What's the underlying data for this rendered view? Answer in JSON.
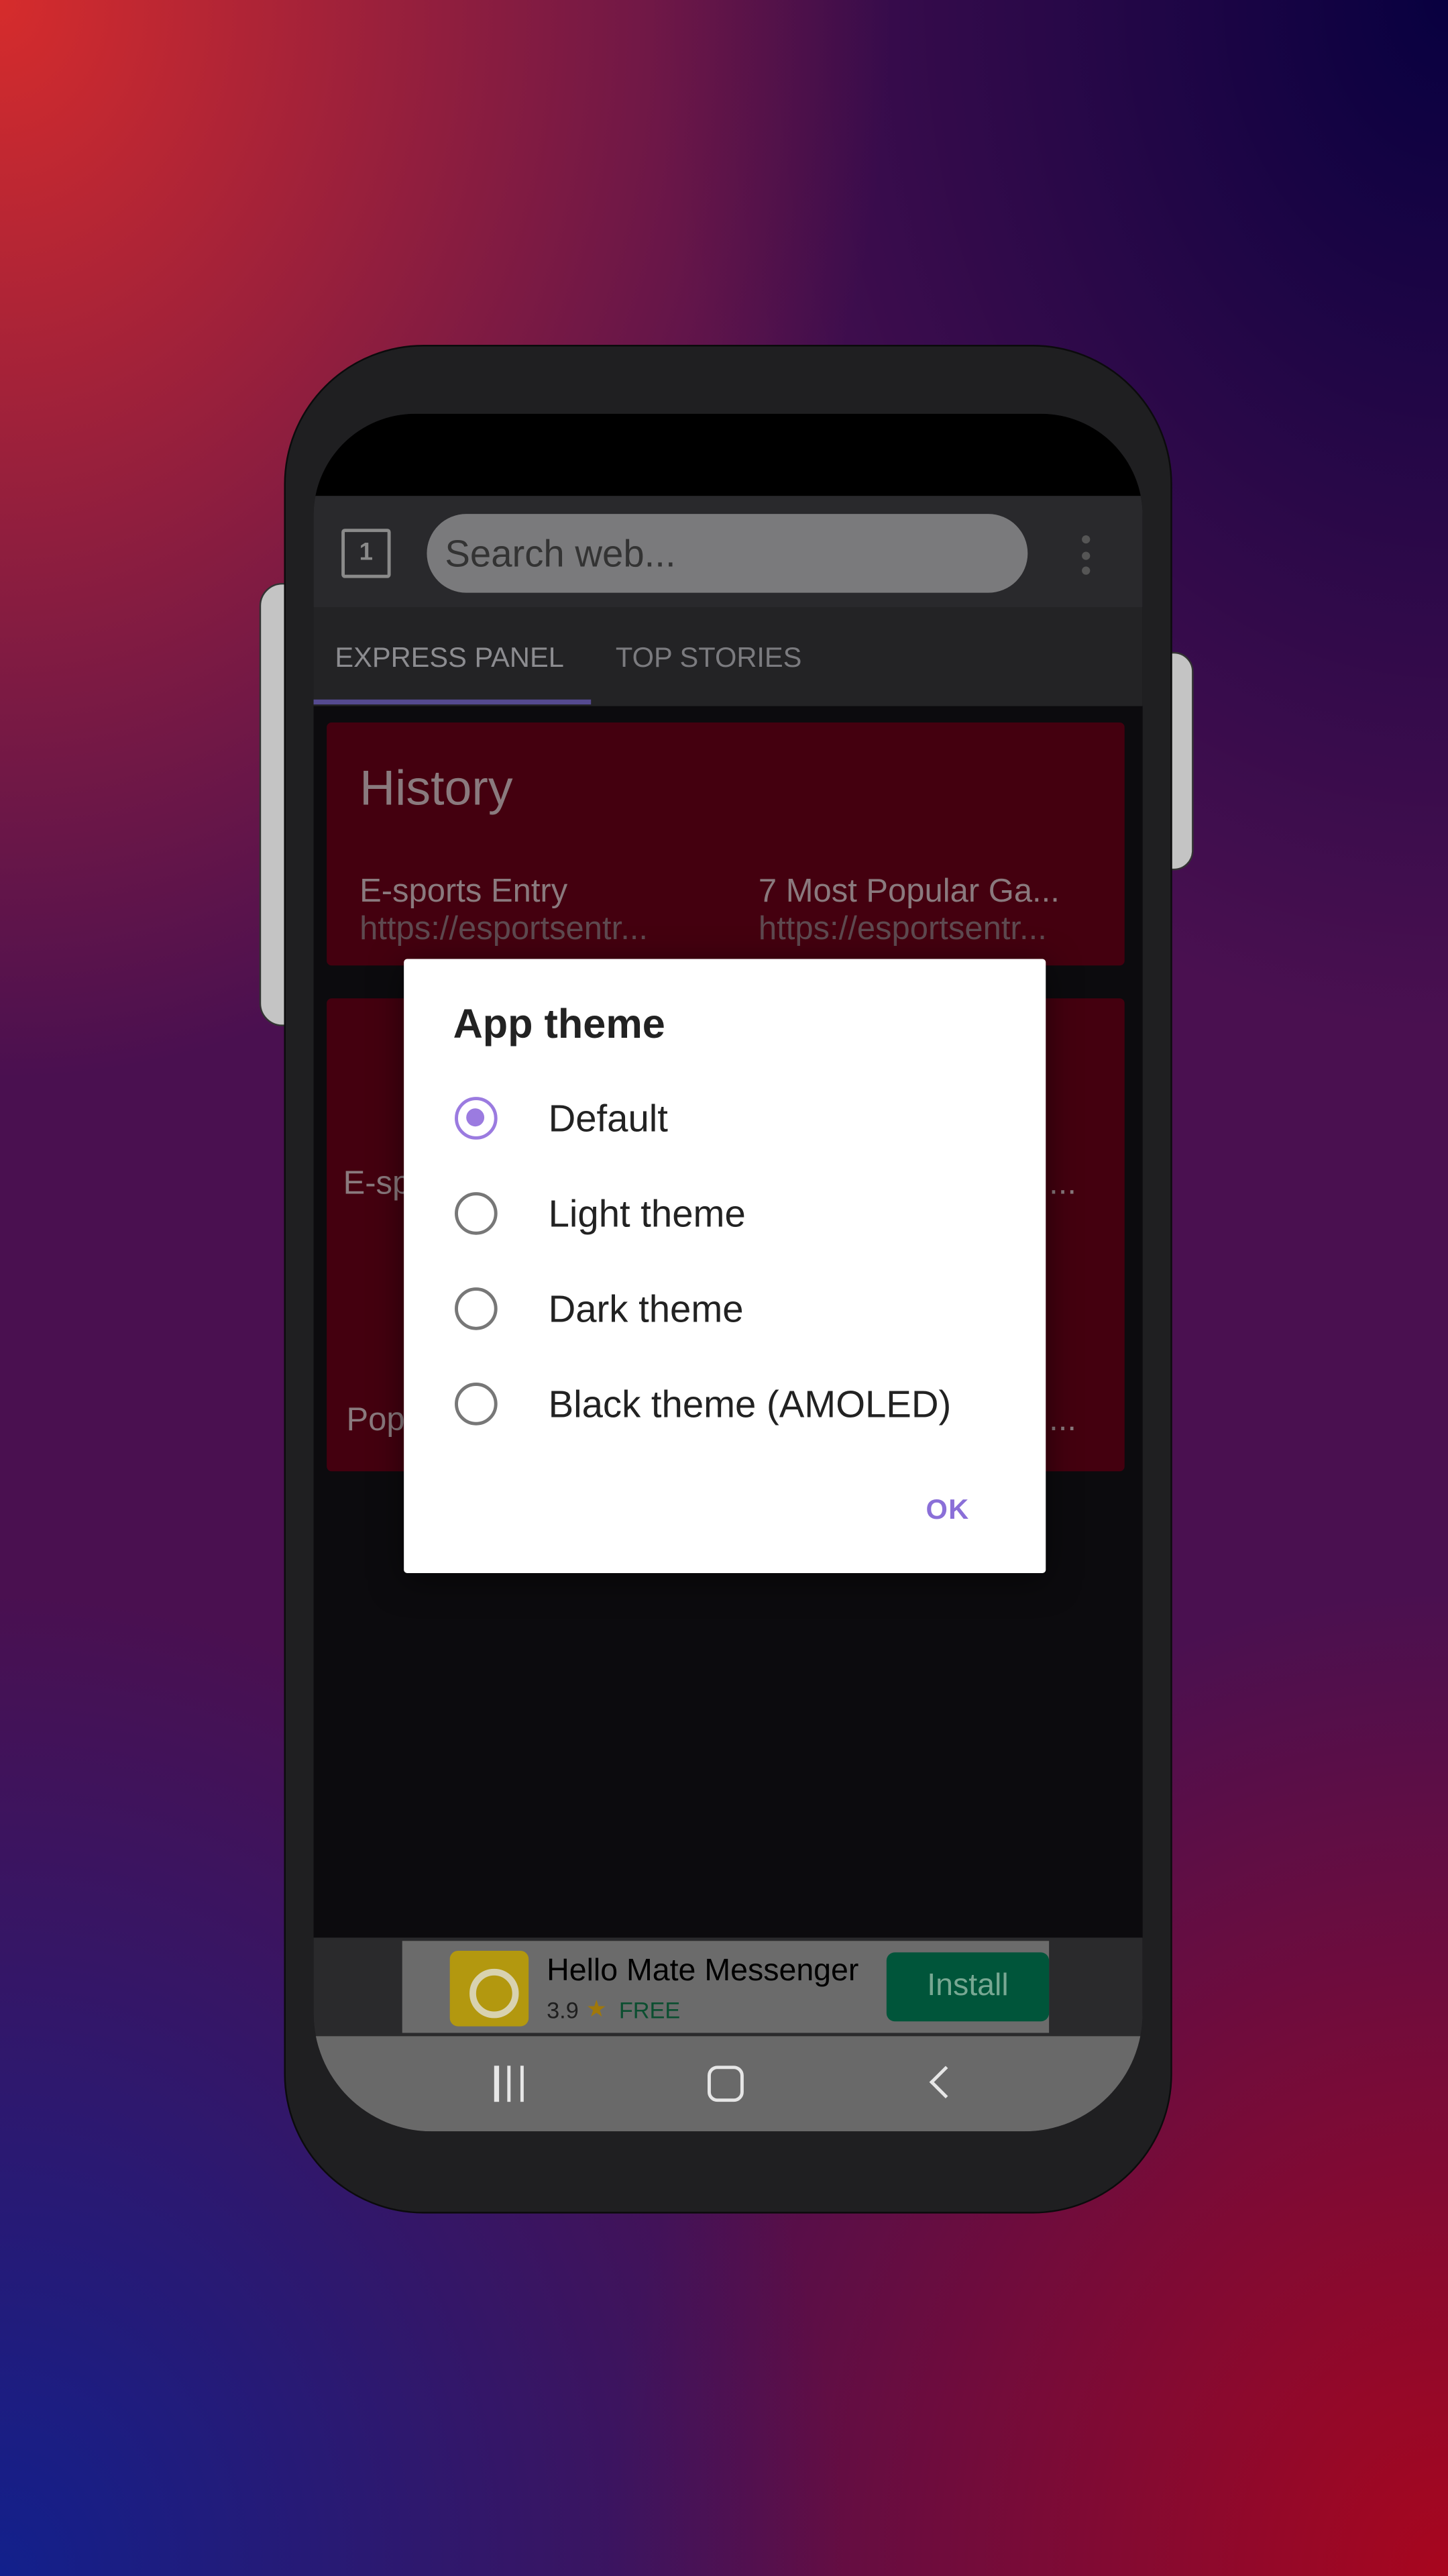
{
  "colors": {
    "accent": "#8a6fd8",
    "card": "#44000f",
    "install": "#00553a"
  },
  "toolbar": {
    "tab_count": "1",
    "search_placeholder": "Search web...",
    "menu_icon": "more-vert-icon"
  },
  "tabs": [
    {
      "label": "EXPRESS PANEL",
      "active": true
    },
    {
      "label": "TOP STORIES",
      "active": false
    }
  ],
  "history": {
    "title": "History",
    "items": [
      {
        "title": "E-sports Entry",
        "url": "https://esportsentr..."
      },
      {
        "title": "7 Most Popular Ga...",
        "url": "https://esportsentr..."
      }
    ]
  },
  "card2": {
    "item1_prefix": "E-sp",
    "item2_prefix": "Pop",
    "ellipsis": "..."
  },
  "dialog": {
    "title": "App theme",
    "options": [
      {
        "label": "Default",
        "selected": true
      },
      {
        "label": "Light theme",
        "selected": false
      },
      {
        "label": "Dark theme",
        "selected": false
      },
      {
        "label": "Black theme (AMOLED)",
        "selected": false
      }
    ],
    "ok_label": "OK"
  },
  "ad": {
    "title": "Hello Mate Messenger",
    "rating": "3.9",
    "star": "★",
    "price": "FREE",
    "install_label": "Install"
  },
  "navbar": {
    "recents": "|||",
    "back": "‹"
  }
}
